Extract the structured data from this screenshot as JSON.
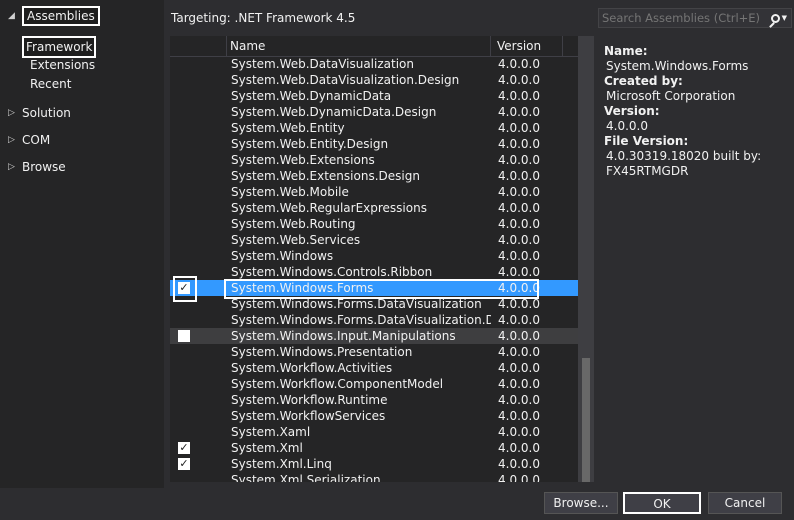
{
  "left_nav": {
    "assemblies": "Assemblies",
    "framework": "Framework",
    "extensions": "Extensions",
    "recent": "Recent",
    "solution": "Solution",
    "com": "COM",
    "browse": "Browse"
  },
  "top_bar": {
    "targeting": "Targeting: .NET Framework 4.5",
    "search_placeholder": "Search Assemblies (Ctrl+E)"
  },
  "list": {
    "col_name": "Name",
    "col_version": "Version",
    "rows": [
      {
        "name": "System.Web.DataVisualization",
        "version": "4.0.0.0",
        "checked": false
      },
      {
        "name": "System.Web.DataVisualization.Design",
        "version": "4.0.0.0",
        "checked": false
      },
      {
        "name": "System.Web.DynamicData",
        "version": "4.0.0.0",
        "checked": false
      },
      {
        "name": "System.Web.DynamicData.Design",
        "version": "4.0.0.0",
        "checked": false
      },
      {
        "name": "System.Web.Entity",
        "version": "4.0.0.0",
        "checked": false
      },
      {
        "name": "System.Web.Entity.Design",
        "version": "4.0.0.0",
        "checked": false
      },
      {
        "name": "System.Web.Extensions",
        "version": "4.0.0.0",
        "checked": false
      },
      {
        "name": "System.Web.Extensions.Design",
        "version": "4.0.0.0",
        "checked": false
      },
      {
        "name": "System.Web.Mobile",
        "version": "4.0.0.0",
        "checked": false
      },
      {
        "name": "System.Web.RegularExpressions",
        "version": "4.0.0.0",
        "checked": false
      },
      {
        "name": "System.Web.Routing",
        "version": "4.0.0.0",
        "checked": false
      },
      {
        "name": "System.Web.Services",
        "version": "4.0.0.0",
        "checked": false
      },
      {
        "name": "System.Windows",
        "version": "4.0.0.0",
        "checked": false
      },
      {
        "name": "System.Windows.Controls.Ribbon",
        "version": "4.0.0.0",
        "checked": false
      },
      {
        "name": "System.Windows.Forms",
        "version": "4.0.0.0",
        "checked": true,
        "state": "selected"
      },
      {
        "name": "System.Windows.Forms.DataVisualization",
        "version": "4.0.0.0",
        "checked": false
      },
      {
        "name": "System.Windows.Forms.DataVisualization.Design",
        "version": "4.0.0.0",
        "checked": false
      },
      {
        "name": "System.Windows.Input.Manipulations",
        "version": "4.0.0.0",
        "checked": false,
        "state": "hover",
        "show_box": true
      },
      {
        "name": "System.Windows.Presentation",
        "version": "4.0.0.0",
        "checked": false
      },
      {
        "name": "System.Workflow.Activities",
        "version": "4.0.0.0",
        "checked": false
      },
      {
        "name": "System.Workflow.ComponentModel",
        "version": "4.0.0.0",
        "checked": false
      },
      {
        "name": "System.Workflow.Runtime",
        "version": "4.0.0.0",
        "checked": false
      },
      {
        "name": "System.WorkflowServices",
        "version": "4.0.0.0",
        "checked": false
      },
      {
        "name": "System.Xaml",
        "version": "4.0.0.0",
        "checked": false
      },
      {
        "name": "System.Xml",
        "version": "4.0.0.0",
        "checked": true
      },
      {
        "name": "System.Xml.Linq",
        "version": "4.0.0.0",
        "checked": true
      },
      {
        "name": "System.Xml.Serialization",
        "version": "4.0.0.0",
        "checked": false
      }
    ]
  },
  "details": {
    "name_label": "Name:",
    "name_value": "System.Windows.Forms",
    "created_label": "Created by:",
    "created_value": "Microsoft Corporation",
    "version_label": "Version:",
    "version_value": "4.0.0.0",
    "file_version_label": "File Version:",
    "file_version_value_1": "4.0.30319.18020 built by:",
    "file_version_value_2": "FX45RTMGDR"
  },
  "buttons": {
    "browse": "Browse...",
    "ok": "OK",
    "cancel": "Cancel"
  },
  "colors": {
    "selection": "#3399ff",
    "background": "#2d2d30",
    "pane": "#252526"
  }
}
